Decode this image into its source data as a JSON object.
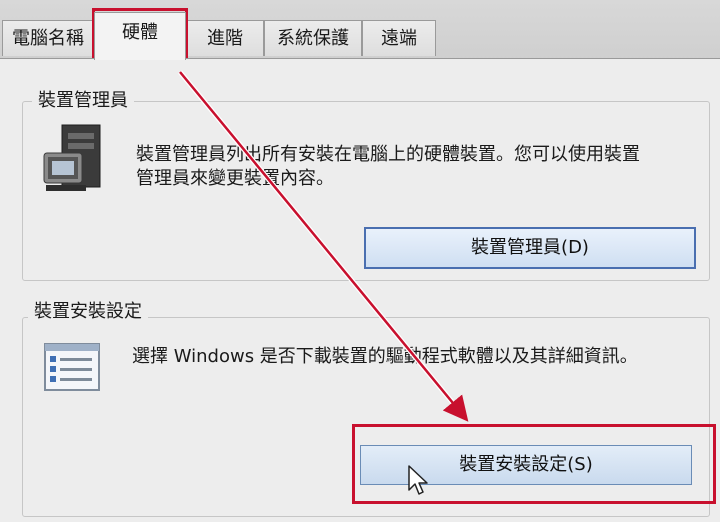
{
  "tabs": [
    {
      "label": "電腦名稱"
    },
    {
      "label": "硬體"
    },
    {
      "label": "進階"
    },
    {
      "label": "系統保護"
    },
    {
      "label": "遠端"
    }
  ],
  "device_manager": {
    "title": "裝置管理員",
    "description_line1": "裝置管理員列出所有安裝在電腦上的硬體裝置。您可以使用裝置",
    "description_line2": "管理員來變更裝置內容。",
    "button_label": "裝置管理員(D)"
  },
  "device_installation": {
    "title": "裝置安裝設定",
    "description": "選擇 Windows 是否下載裝置的驅動程式軟體以及其詳細資訊。",
    "button_label": "裝置安裝設定(S)"
  },
  "colors": {
    "highlight": "#c8102e",
    "button_border": "#4a6fb0"
  },
  "icons": {
    "device_manager": "device-manager-icon",
    "device_installation": "checklist-icon",
    "cursor": "mouse-pointer-icon"
  }
}
